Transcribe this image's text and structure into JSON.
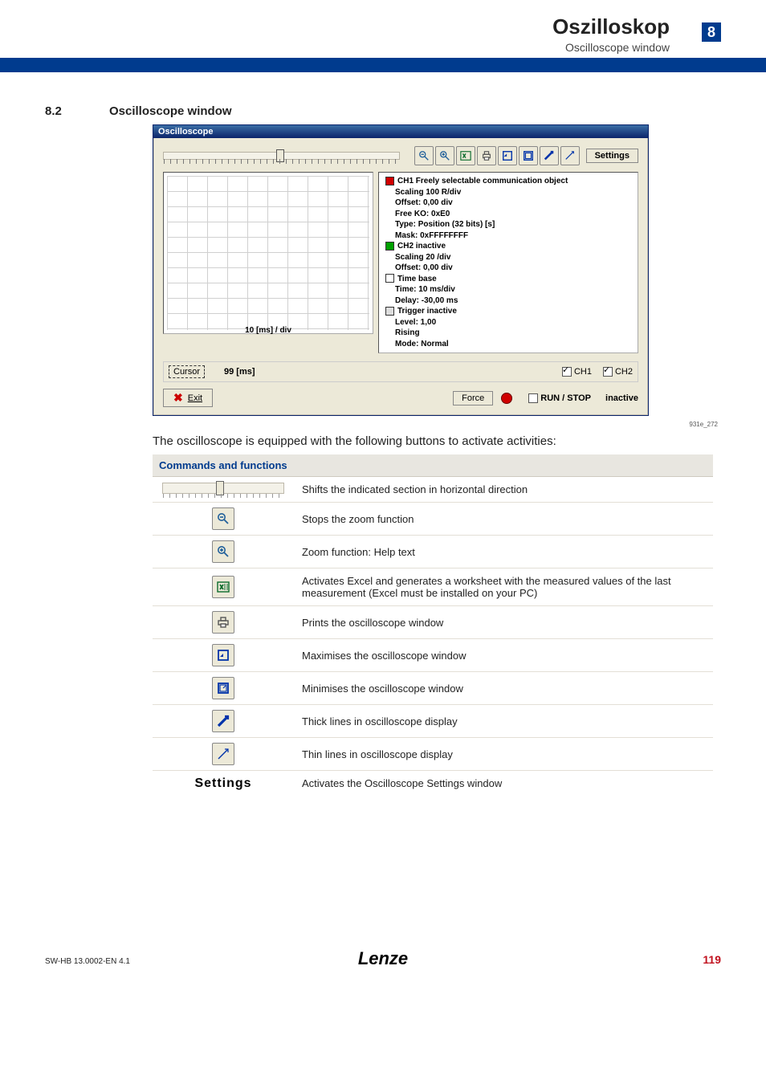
{
  "header": {
    "title": "Oszilloskop",
    "subtitle": "Oscilloscope window",
    "chapter_badge": "8"
  },
  "section": {
    "number": "8.2",
    "title": "Oscilloscope window"
  },
  "scope_window": {
    "title": "Oscilloscope",
    "settings_btn": "Settings",
    "xaxis_label": "10 [ms] / div",
    "tree": {
      "ch1": {
        "label": "CH1 Freely selectable communication object",
        "items": [
          "Scaling 100  R/div",
          "Offset: 0,00  div",
          "Free KO: 0xE0",
          "Type: Position (32 bits) [s]",
          "Mask: 0xFFFFFFFF"
        ]
      },
      "ch2": {
        "label": "CH2 inactive",
        "items": [
          "Scaling 20 /div",
          "Offset: 0,00  div"
        ]
      },
      "timebase": {
        "label": "Time base",
        "items": [
          "Time: 10  ms/div",
          "Delay: -30,00  ms"
        ]
      },
      "trigger": {
        "label": "Trigger inactive",
        "items": [
          "Level: 1,00",
          "Rising",
          "Mode: Normal"
        ]
      }
    },
    "midbar": {
      "cursor": "Cursor",
      "value": "99 [ms]",
      "ch1": "CH1",
      "ch2": "CH2"
    },
    "bottom": {
      "exit": "Exit",
      "force": "Force",
      "runstop": "RUN / STOP",
      "status": "inactive"
    }
  },
  "figure_ref": "931e_272",
  "intro_text": "The oscilloscope is equipped with the following buttons to activate activities:",
  "table_header": "Commands and functions",
  "functions": {
    "scroll": "Shifts the indicated section in horizontal direction",
    "zoom_out": "Stops the zoom function",
    "zoom_in": "Zoom function: Help text",
    "excel": "Activates Excel and generates a worksheet with the measured values of the last measurement (Excel must be installed on your PC)",
    "print": "Prints the oscilloscope window",
    "maximize": "Maximises the oscilloscope window",
    "minimize": "Minimises the oscilloscope window",
    "thick": "Thick lines in oscilloscope display",
    "thin": "Thin lines in oscilloscope display",
    "settings": "Activates the Oscilloscope Settings window"
  },
  "settings_label": "Settings",
  "footer": {
    "left": "SW-HB 13.0002-EN    4.1",
    "logo": "Lenze",
    "page": "119"
  }
}
